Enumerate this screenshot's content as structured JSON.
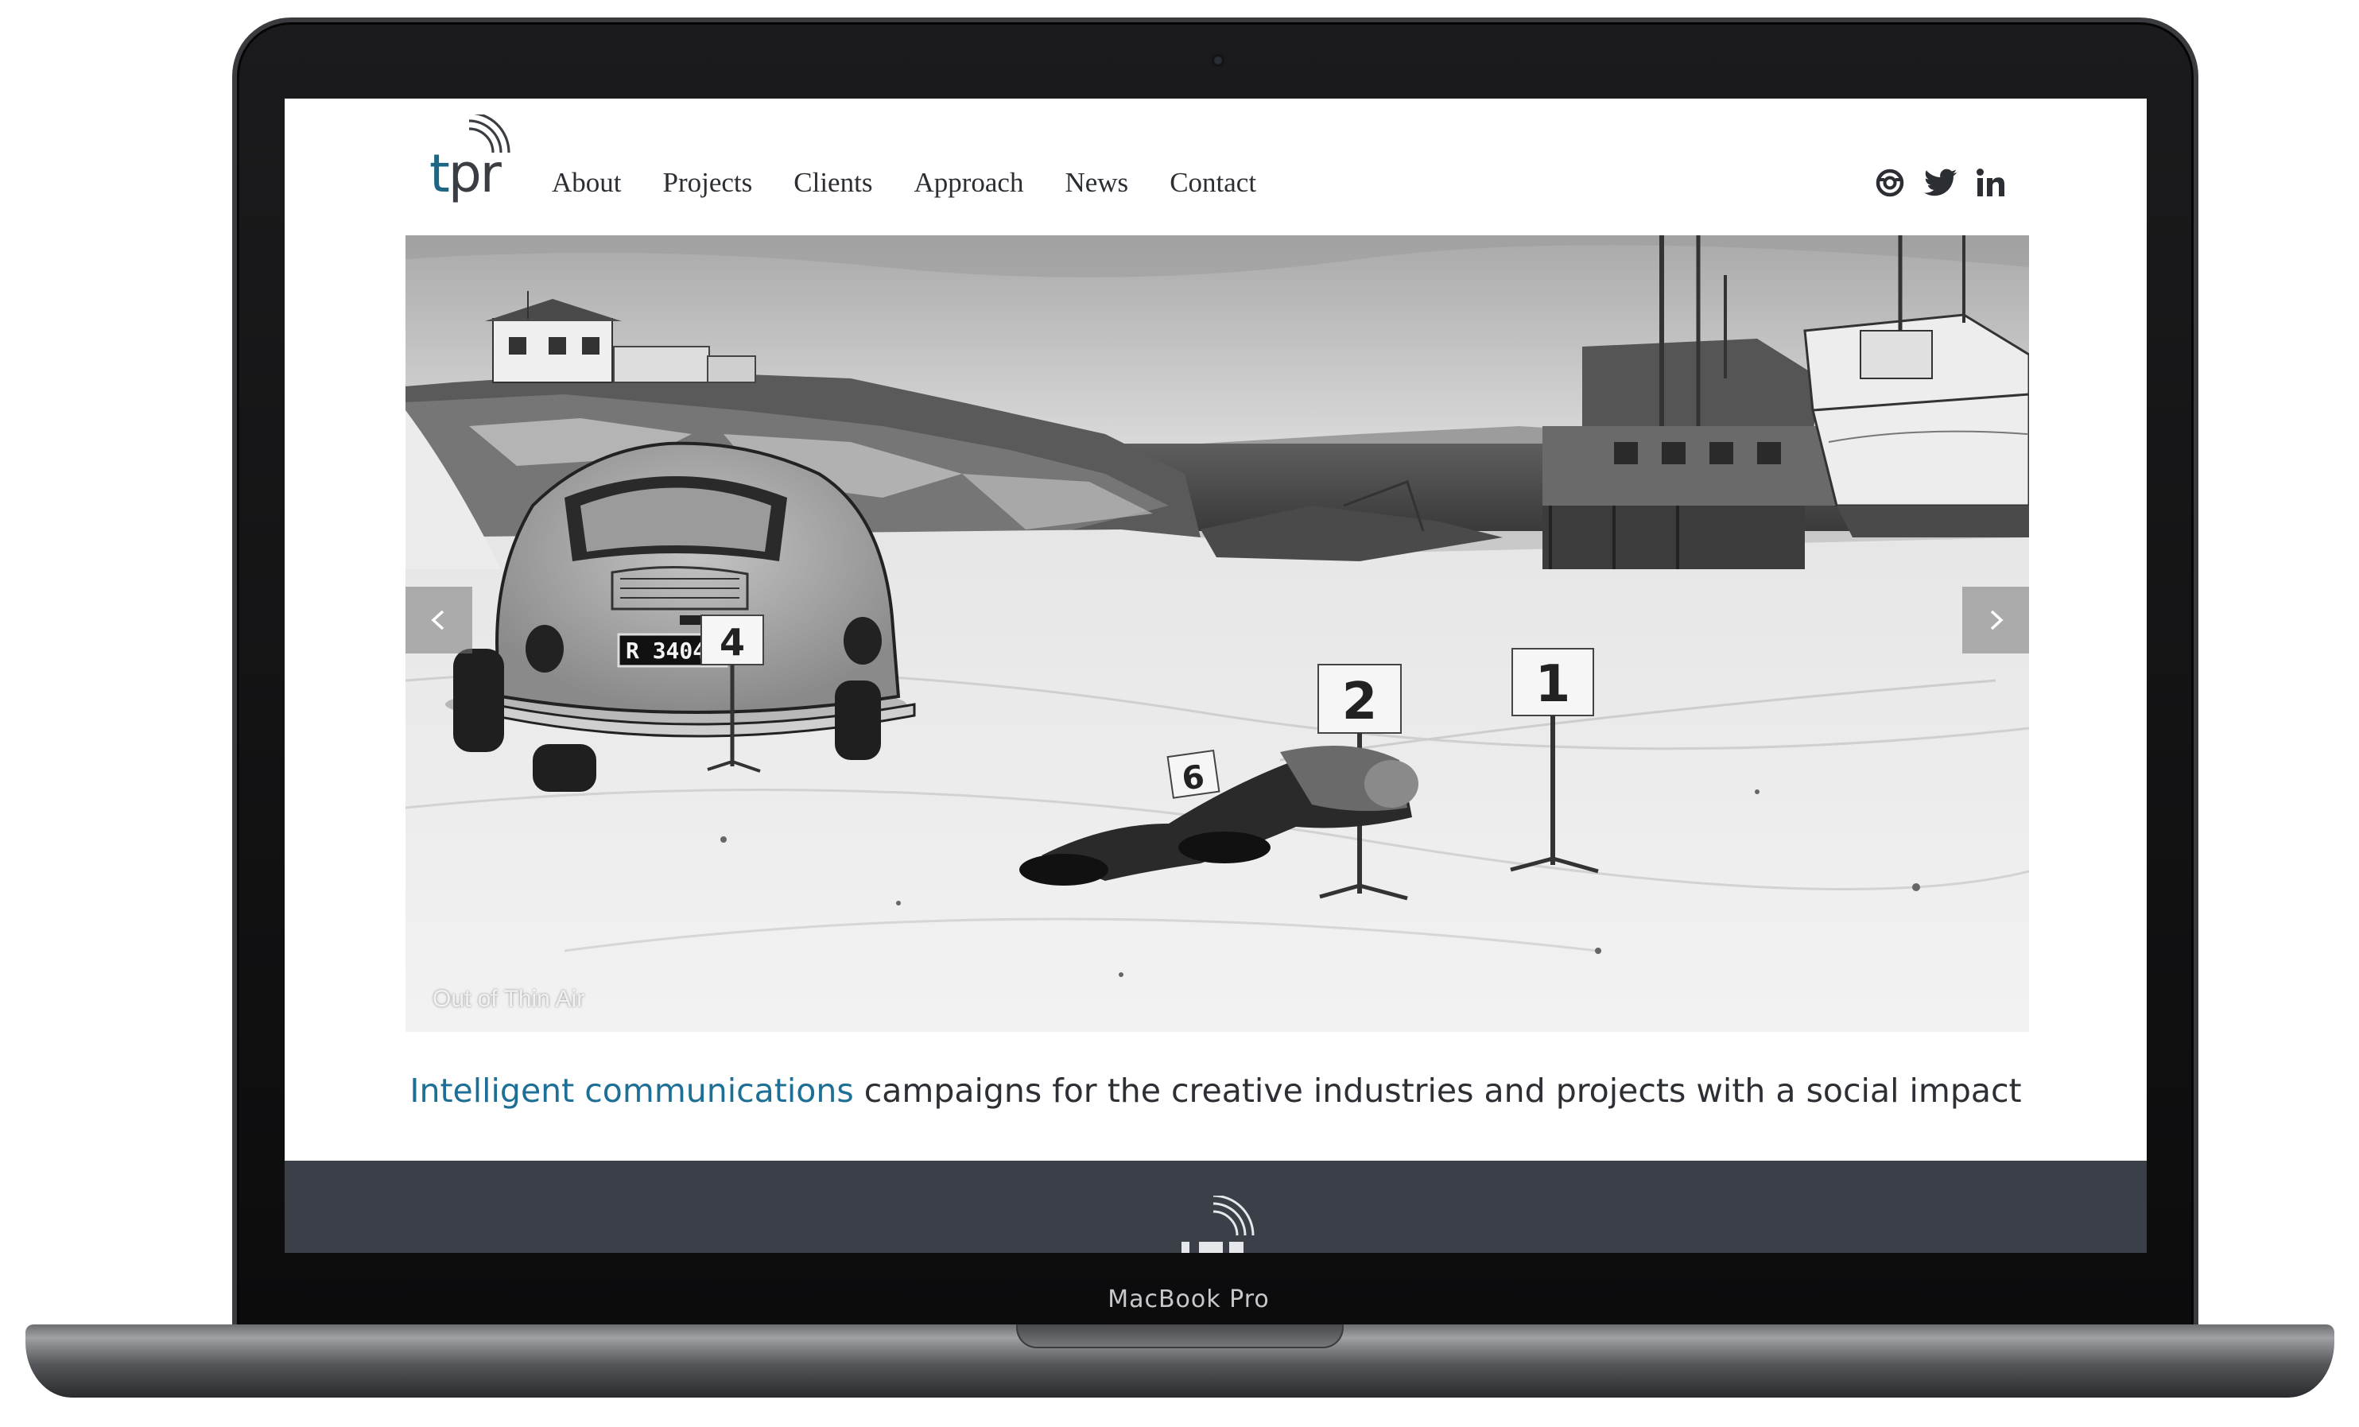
{
  "device": {
    "label": "MacBook Pro"
  },
  "header": {
    "logo": {
      "t": "t",
      "pr": "pr"
    },
    "nav": [
      {
        "label": "About"
      },
      {
        "label": "Projects"
      },
      {
        "label": "Clients"
      },
      {
        "label": "Approach"
      },
      {
        "label": "News"
      },
      {
        "label": "Contact"
      }
    ],
    "social": [
      {
        "icon": "instagram-icon"
      },
      {
        "icon": "twitter-icon"
      },
      {
        "icon": "linkedin-icon"
      }
    ]
  },
  "hero": {
    "caption": "Out of Thin Air",
    "plate": "R 34042",
    "markers": [
      "4",
      "2",
      "1",
      "6"
    ]
  },
  "tagline": {
    "accent": "Intelligent communications",
    "rest": " campaigns for the creative industries and projects with a social impact"
  },
  "colors": {
    "brand_blue": "#1d6784",
    "accent_blue": "#1d6f95",
    "text_dark": "#2b2e33",
    "footer_bg": "#3a3f48"
  }
}
